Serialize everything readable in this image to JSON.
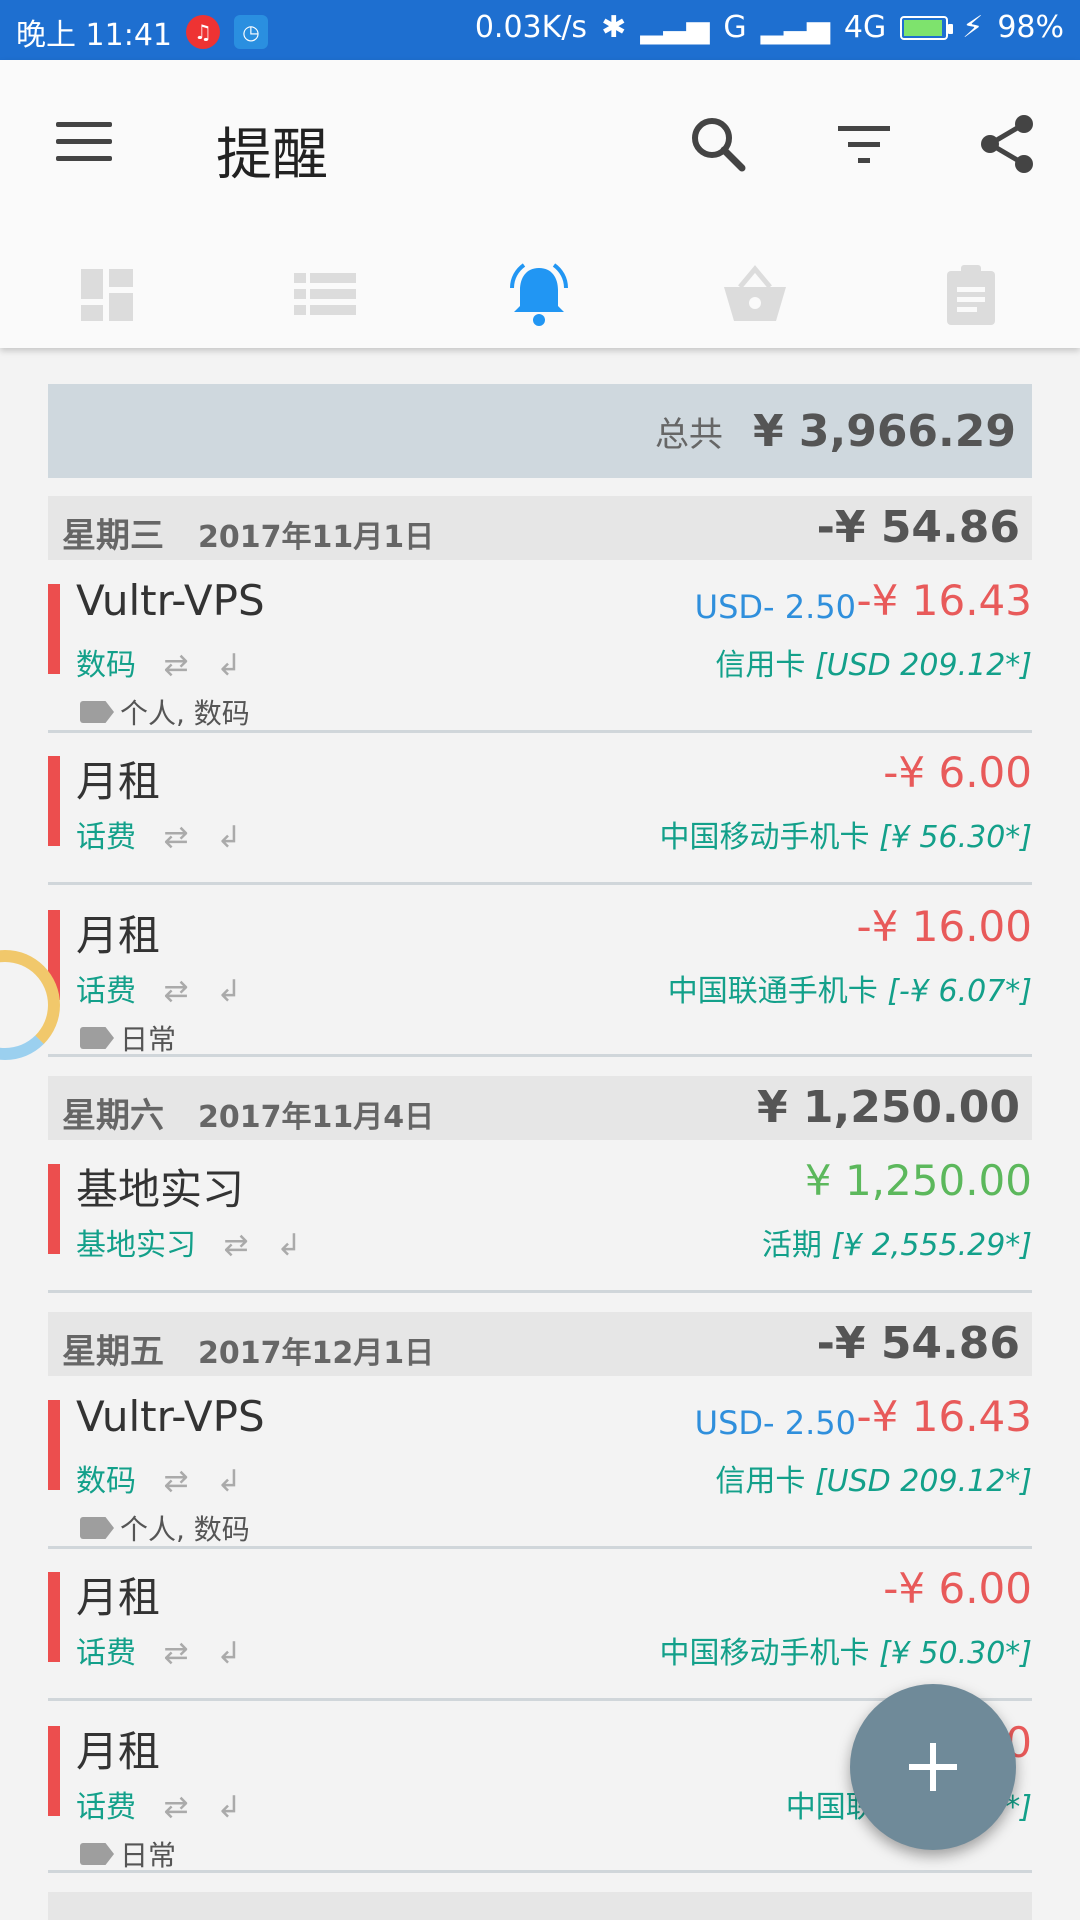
{
  "status_bar": {
    "time": "晚上 11:41",
    "speed": "0.03K/s",
    "signal1": "G",
    "signal2": "4G",
    "battery": "98%"
  },
  "app_bar": {
    "title": "提醒"
  },
  "tabs": [
    {
      "name": "dashboard-icon",
      "active": false
    },
    {
      "name": "list-icon",
      "active": false
    },
    {
      "name": "bell-icon",
      "active": true
    },
    {
      "name": "basket-icon",
      "active": false
    },
    {
      "name": "clipboard-icon",
      "active": false
    }
  ],
  "summary": {
    "label": "总共",
    "total": "¥ 3,966.29"
  },
  "days": [
    {
      "weekday": "星期三",
      "date": "2017年11月1日",
      "sum": "-¥ 54.86",
      "entries": [
        {
          "name": "Vultr-VPS",
          "category": "数码",
          "usd": "USD- 2.50",
          "amount": "-¥ 16.43",
          "account": "信用卡",
          "balance": "[USD 209.12*]",
          "tags": "个人, 数码"
        },
        {
          "name": "月租",
          "category": "话费",
          "amount": "-¥ 6.00",
          "account": "中国移动手机卡",
          "balance": "[¥ 56.30*]"
        },
        {
          "name": "月租",
          "category": "话费",
          "amount": "-¥ 16.00",
          "account": "中国联通手机卡",
          "balance": "[-¥ 6.07*]",
          "tags": "日常"
        }
      ]
    },
    {
      "weekday": "星期六",
      "date": "2017年11月4日",
      "sum": "¥ 1,250.00",
      "entries": [
        {
          "name": "基地实习",
          "category": "基地实习",
          "amount": "¥ 1,250.00",
          "account": "活期",
          "balance": "[¥ 2,555.29*]"
        }
      ]
    },
    {
      "weekday": "星期五",
      "date": "2017年12月1日",
      "sum": "-¥ 54.86",
      "entries": [
        {
          "name": "Vultr-VPS",
          "category": "数码",
          "usd": "USD- 2.50",
          "amount": "-¥ 16.43",
          "account": "信用卡",
          "balance": "[USD 209.12*]",
          "tags": "个人, 数码"
        },
        {
          "name": "月租",
          "category": "话费",
          "amount": "-¥ 6.00",
          "account": "中国移动手机卡",
          "balance": "[¥ 50.30*]"
        },
        {
          "name": "月租",
          "category": "话费",
          "amount": "0",
          "account": "中国联通手机卡",
          "balance": "*]",
          "tags": "日常"
        }
      ]
    }
  ],
  "colors": {
    "status_bar": "#1e6fd0",
    "accent": "#2196f3",
    "expense": "#e85a5a",
    "income": "#5cb85c",
    "category": "#13a08a",
    "fab": "#6f8a99"
  }
}
